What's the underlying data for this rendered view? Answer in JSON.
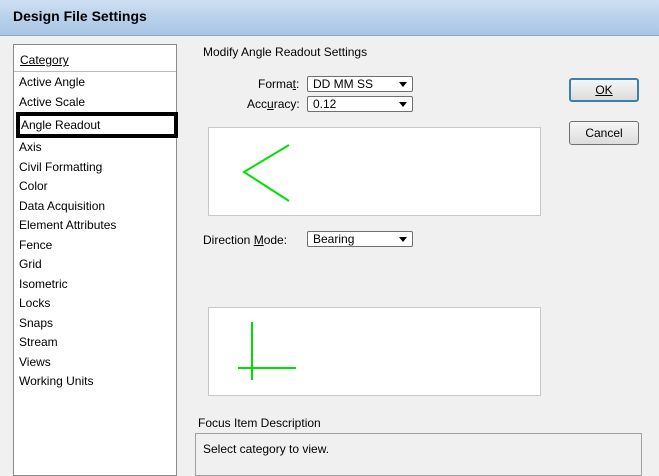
{
  "window": {
    "title": "Design File Settings"
  },
  "category": {
    "header": "Category",
    "items": [
      "Active Angle",
      "Active Scale",
      "Angle Readout",
      "Axis",
      "Civil Formatting",
      "Color",
      "Data Acquisition",
      "Element Attributes",
      "Fence",
      "Grid",
      "Isometric",
      "Locks",
      "Snaps",
      "Stream",
      "Views",
      "Working Units"
    ],
    "selected": "Angle Readout"
  },
  "settings": {
    "heading": "Modify Angle Readout Settings",
    "format": {
      "label_pre": "Forma",
      "label_key": "t",
      "label_post": ":",
      "value": "DD MM SS"
    },
    "accuracy": {
      "label_pre": "Acc",
      "label_key": "u",
      "label_post": "racy:",
      "value": "0.12"
    },
    "direction_mode": {
      "label_pre": "Direction ",
      "label_key": "M",
      "label_post": "ode:",
      "value": "Bearing"
    }
  },
  "buttons": {
    "ok": "OK",
    "cancel": "Cancel"
  },
  "focus": {
    "label": "Focus Item Description",
    "text": "Select category to view."
  },
  "colors": {
    "preview_line": "#00e000",
    "selection_border": "#000000"
  }
}
